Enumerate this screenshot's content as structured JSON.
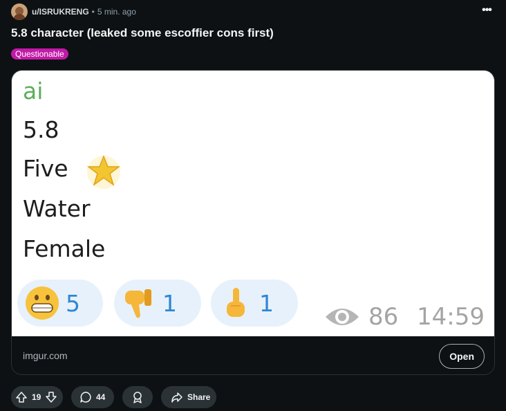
{
  "post": {
    "author": "u/ISRUKRENG",
    "separator": "•",
    "time": "5 min. ago",
    "more_label": "•••",
    "title": "5.8 character (leaked some escoffier cons first)",
    "flair": "Questionable"
  },
  "image_content": {
    "line_ai": "ai",
    "line1": "5.8",
    "line2": "Five",
    "line3": "Water",
    "line4": "Female",
    "reactions": [
      {
        "icon": "grinning-face-icon",
        "count": "5"
      },
      {
        "icon": "thumbs-down-icon",
        "count": "1"
      },
      {
        "icon": "middle-finger-icon",
        "count": "1"
      }
    ],
    "views": "86",
    "timestamp": "14:59"
  },
  "link": {
    "domain": "imgur.com",
    "open_label": "Open"
  },
  "actions": {
    "score": "19",
    "comments": "44",
    "share_label": "Share"
  },
  "colors": {
    "background": "#0e1113",
    "flair": "#c21aa8",
    "pill": "#2a3236",
    "reaction_count": "#2f86d3"
  }
}
